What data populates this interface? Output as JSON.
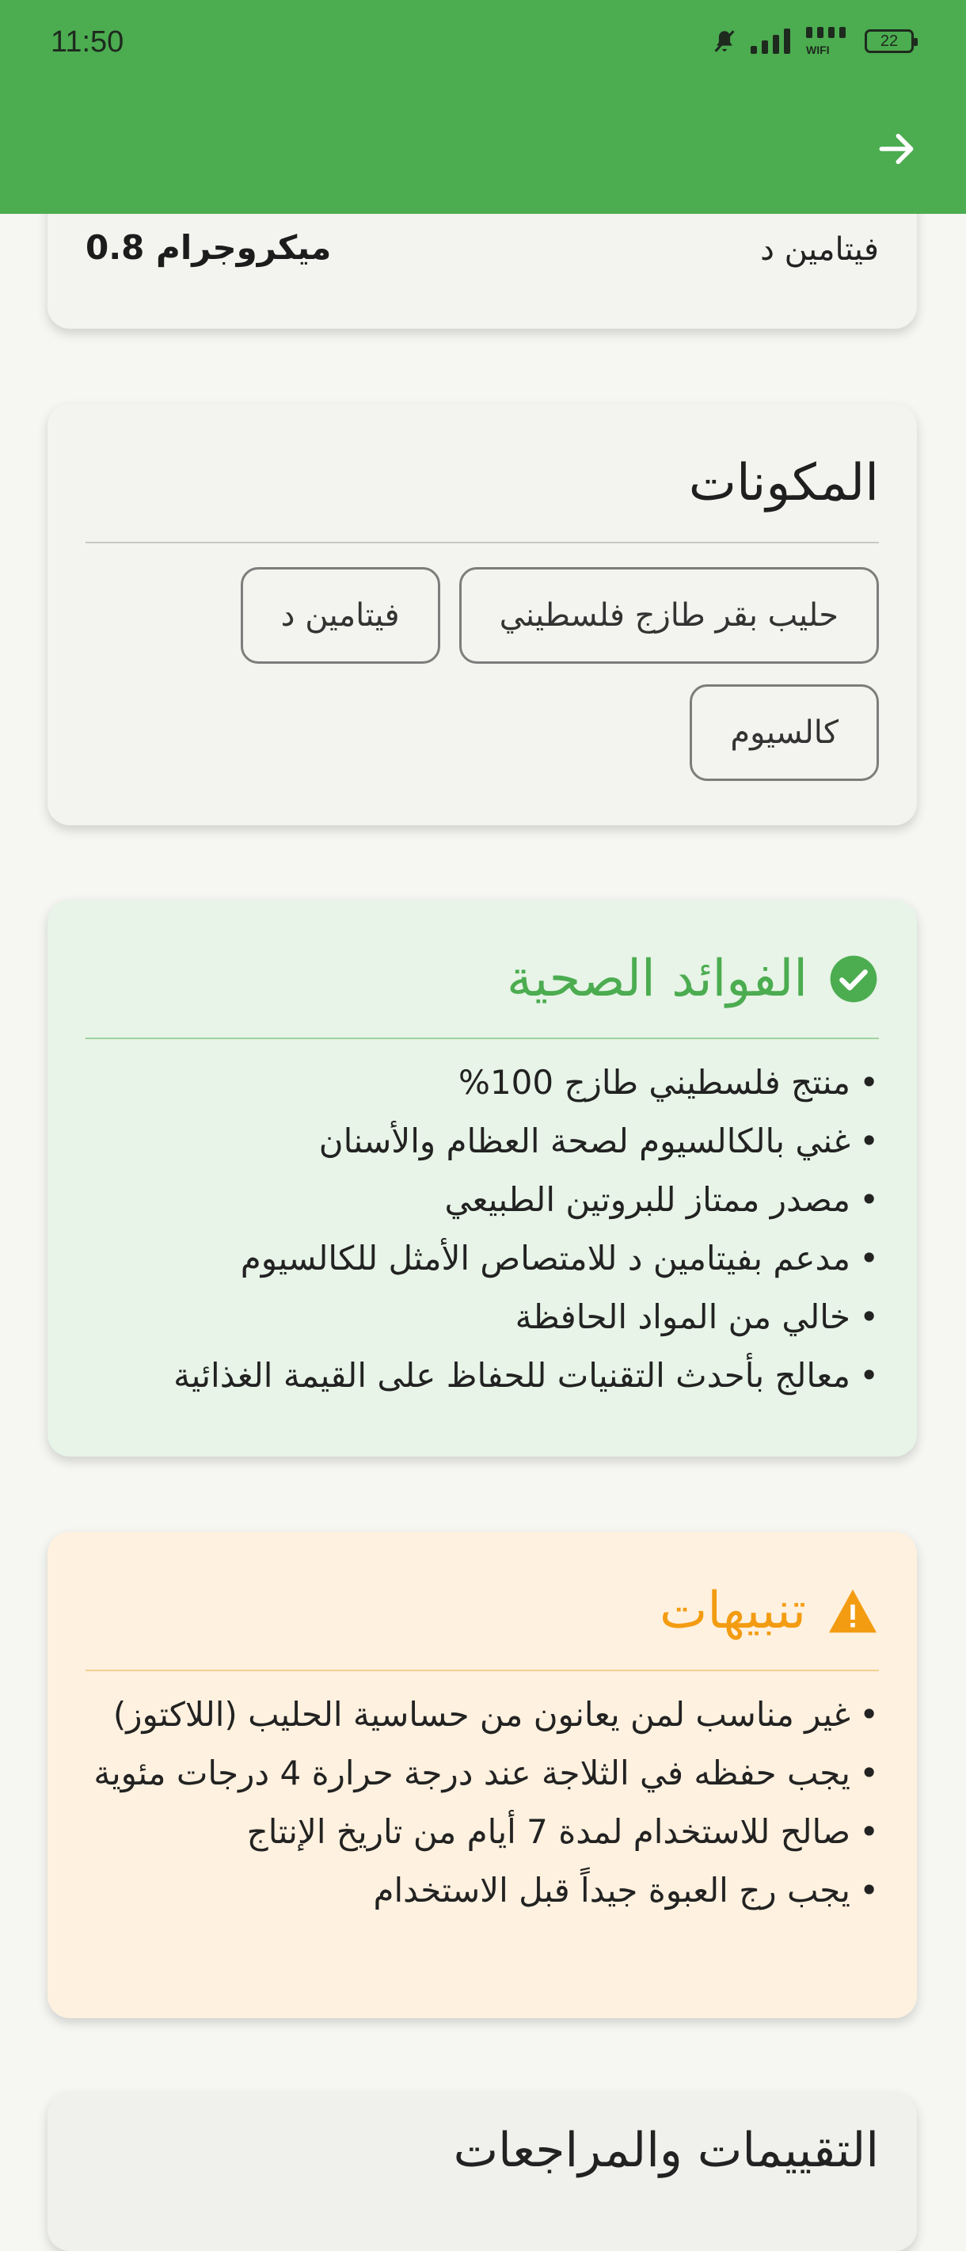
{
  "status_bar": {
    "time": "11:50",
    "wifi_label": "WIFI",
    "battery": "22"
  },
  "colors": {
    "appbar": "#4CAC50",
    "benefits_accent": "#4CAC50",
    "warnings_accent": "#F39C12"
  },
  "previous_card": {
    "label": "فيتامين د",
    "value": "0.8 ميكروجرام"
  },
  "ingredients": {
    "title": "المكونات",
    "chips": [
      "حليب بقر طازج فلسطيني",
      "فيتامين د",
      "كالسيوم"
    ]
  },
  "benefits": {
    "title": "الفوائد الصحية",
    "icon": "check-circle-icon",
    "items": [
      "منتج فلسطيني طازج 100%",
      "غني بالكالسيوم لصحة العظام والأسنان",
      "مصدر ممتاز للبروتين الطبيعي",
      "مدعم بفيتامين د للامتصاص الأمثل للكالسيوم",
      "خالي من المواد الحافظة",
      "معالج بأحدث التقنيات للحفاظ على القيمة الغذائية"
    ]
  },
  "warnings": {
    "title": "تنبيهات",
    "icon": "warning-icon",
    "items": [
      "غير مناسب لمن يعانون من حساسية الحليب (اللاكتوز)",
      "يجب حفظه في الثلاجة عند درجة حرارة 4 درجات مئوية",
      "صالح للاستخدام لمدة 7 أيام من تاريخ الإنتاج",
      "يجب رج العبوة جيداً قبل الاستخدام"
    ]
  },
  "next_card": {
    "title": "التقييمات والمراجعات"
  }
}
